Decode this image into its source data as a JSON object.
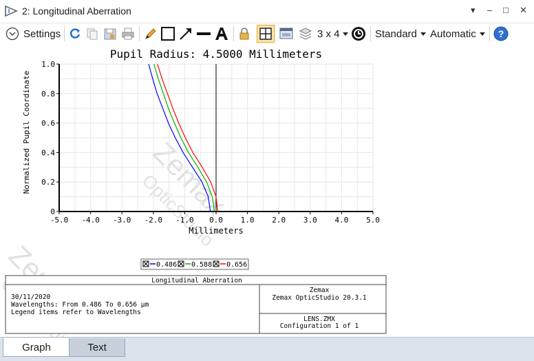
{
  "window": {
    "title": "2: Longitudinal Aberration",
    "controls": [
      "▾",
      "–",
      "□",
      "✕"
    ]
  },
  "toolbar": {
    "settings_label": "Settings",
    "layout_label": "3 x 4",
    "standard_label": "Standard",
    "automatic_label": "Automatic",
    "icons": [
      "refresh-icon",
      "copy-icon",
      "save-icon",
      "print-icon",
      "pencil-icon",
      "rectangle-icon",
      "arrow-icon",
      "line-icon",
      "text-icon",
      "lock-icon",
      "grid-icon",
      "window-icon",
      "layers-icon",
      "dropdown-icon",
      "clock-icon",
      "help-icon"
    ]
  },
  "chart_data": {
    "type": "line",
    "title": "Pupil Radius: 4.5000 Millimeters",
    "xlabel": "Millimeters",
    "ylabel": "Normalized Pupil Coordinate",
    "xlim": [
      -5.0,
      5.0
    ],
    "ylim": [
      0,
      1.0
    ],
    "x_ticks": [
      "-5.0",
      "-4.0",
      "-3.0",
      "-2.0",
      "-1.0",
      "0.0",
      "1.0",
      "2.0",
      "3.0",
      "4.0",
      "5.0"
    ],
    "y_ticks": [
      "0",
      "0.2",
      "0.4",
      "0.6",
      "0.8",
      "1.0"
    ],
    "grid": true,
    "series": [
      {
        "name": "0.486",
        "color": "#0000ff",
        "points": [
          [
            -0.18,
            0
          ],
          [
            -0.25,
            0.1
          ],
          [
            -0.45,
            0.2
          ],
          [
            -0.75,
            0.3
          ],
          [
            -1.05,
            0.4
          ],
          [
            -1.3,
            0.5
          ],
          [
            -1.52,
            0.6
          ],
          [
            -1.7,
            0.7
          ],
          [
            -1.88,
            0.8
          ],
          [
            -2.02,
            0.9
          ],
          [
            -2.15,
            1.0
          ]
        ]
      },
      {
        "name": "0.588",
        "color": "#00b000",
        "points": [
          [
            -0.05,
            0
          ],
          [
            -0.12,
            0.1
          ],
          [
            -0.3,
            0.2
          ],
          [
            -0.58,
            0.3
          ],
          [
            -0.88,
            0.4
          ],
          [
            -1.12,
            0.5
          ],
          [
            -1.33,
            0.6
          ],
          [
            -1.52,
            0.7
          ],
          [
            -1.68,
            0.8
          ],
          [
            -1.84,
            0.9
          ],
          [
            -1.98,
            1.0
          ]
        ]
      },
      {
        "name": "0.656",
        "color": "#ff0000",
        "points": [
          [
            0.05,
            0
          ],
          [
            0.0,
            0.1
          ],
          [
            -0.17,
            0.2
          ],
          [
            -0.44,
            0.3
          ],
          [
            -0.74,
            0.4
          ],
          [
            -0.98,
            0.5
          ],
          [
            -1.19,
            0.6
          ],
          [
            -1.38,
            0.7
          ],
          [
            -1.55,
            0.8
          ],
          [
            -1.72,
            0.9
          ],
          [
            -1.87,
            1.0
          ]
        ]
      }
    ]
  },
  "legend": {
    "items": [
      {
        "label": "0.486",
        "color": "#0000ff"
      },
      {
        "label": "0.588",
        "color": "#00b000"
      },
      {
        "label": "0.656",
        "color": "#ff0000"
      }
    ]
  },
  "info_box": {
    "title": "Longitudinal Aberration",
    "date": "30/11/2020",
    "wavelengths": "Wavelengths: From 0.486 To 0.656 µm",
    "legend_note": "Legend items refer to Wavelengths",
    "company": "Zemax",
    "product": "Zemax OpticStudio 20.3.1",
    "file": "LENS.ZMX",
    "configuration": "Configuration 1 of 1"
  },
  "watermark": {
    "line1": "Zemax",
    "line2": "OpticStudio"
  },
  "tabs": [
    {
      "label": "Graph",
      "active": true
    },
    {
      "label": "Text",
      "active": false
    }
  ]
}
